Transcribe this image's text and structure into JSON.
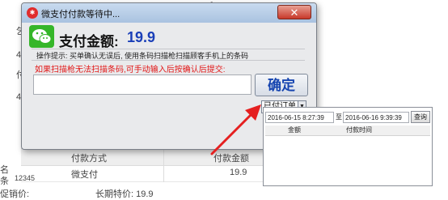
{
  "background": {
    "fragments": [
      "屷",
      "寂",
      "4",
      "/.",
      "9",
      "乞",
      "4",
      "4",
      "付",
      "名",
      "条",
      "12345",
      "促销价:",
      "长期特价: 19.9"
    ],
    "table": {
      "headers": [
        "付款方式",
        "付款金额"
      ],
      "row": [
        "微支付",
        "19.9"
      ]
    }
  },
  "dialog": {
    "title": "微支付付款等待中...",
    "close": "✕",
    "amount_label": "支付金额:",
    "amount_value": "19.9",
    "hint": "操作提示: 买单确认无误后, 使用条码扫描枪扫描顾客手机上的条码",
    "manual_hint": "如果扫描枪无法扫描条码,可手动输入后按确认后提交:",
    "input_value": "",
    "confirm_label": "确定",
    "paid_orders_label": "已付订单",
    "dropdown_glyph": "▼"
  },
  "orders_panel": {
    "start_date": "2016-06-15 8:27:39",
    "to_label": "至",
    "end_date": "2016-06-16 9:39:39",
    "query_label": "查询",
    "columns": [
      "金额",
      "付款时间"
    ]
  },
  "colors": {
    "amount": "#1a3fb8",
    "manual_hint": "#e21818",
    "arrow": "#e52020",
    "wechat": "#35b629"
  },
  "icons": {
    "app": "wechat-pay-icon",
    "logo": "wechat-logo-icon"
  }
}
